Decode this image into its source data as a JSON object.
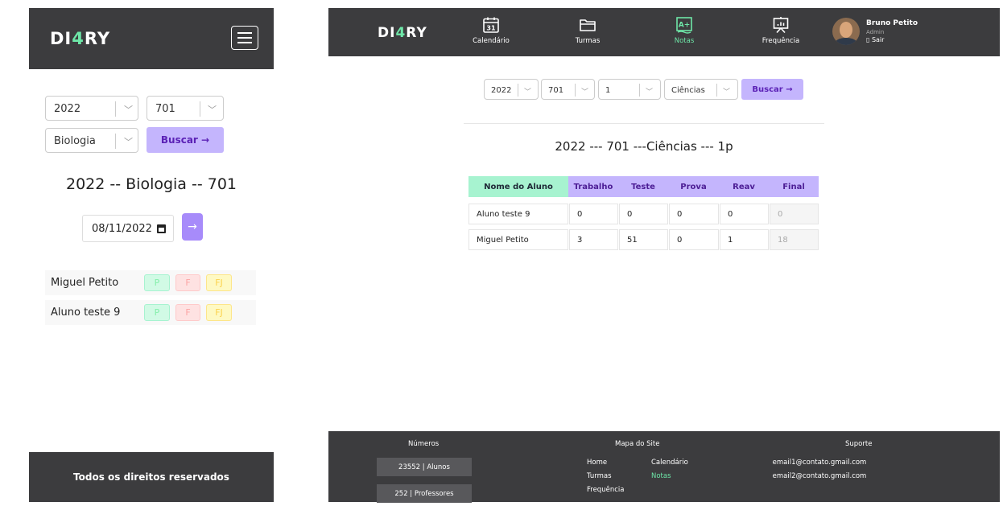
{
  "brand": {
    "logo_prefix": "DI",
    "logo_four": "4",
    "logo_suffix": "RY",
    "accent": "#6ee7a8",
    "purple": "#a78bfa"
  },
  "mobile": {
    "filters": {
      "year": "2022",
      "class": "701",
      "subject": "Biologia",
      "search_label": "Buscar →"
    },
    "title": "2022 -- Biologia -- 701",
    "date": "08/11/2022",
    "submit_arrow": "→",
    "attendance": [
      {
        "name": "Miguel Petito",
        "p": "P",
        "f": "F",
        "fj": "FJ"
      },
      {
        "name": "Aluno teste 9",
        "p": "P",
        "f": "F",
        "fj": "FJ"
      }
    ],
    "footer": "Todos os direitos reservados"
  },
  "desktop": {
    "nav": [
      {
        "label": "Calendário",
        "icon": "calendar-icon",
        "day": "31"
      },
      {
        "label": "Turmas",
        "icon": "folder-icon"
      },
      {
        "label": "Notas",
        "icon": "grades-icon",
        "badge": "A+"
      },
      {
        "label": "Frequência",
        "icon": "presentation-chart-icon"
      }
    ],
    "user": {
      "name": "Bruno Petito",
      "role": "Admin",
      "logout": "▯ Sair"
    },
    "filters": {
      "year": "2022",
      "class": "701",
      "period": "1",
      "subject": "Ciências",
      "search_label": "Buscar →"
    },
    "title": "2022 --- 701 ---Ciências --- 1p",
    "table": {
      "headers": [
        "Nome do Aluno",
        "Trabalho",
        "Teste",
        "Prova",
        "Reav",
        "Final"
      ],
      "rows": [
        [
          "Aluno teste 9",
          "0",
          "0",
          "0",
          "0",
          "0"
        ],
        [
          "Miguel Petito",
          "3",
          "51",
          "0",
          "1",
          "18"
        ]
      ]
    },
    "footer": {
      "numbers_heading": "Números",
      "students": "23552 | Alunos",
      "teachers": "252 | Professores",
      "sitemap_heading": "Mapa do Site",
      "links": {
        "home": "Home",
        "calendar": "Calendário",
        "classes": "Turmas",
        "grades": "Notas",
        "attendance": "Frequência"
      },
      "support_heading": "Suporte",
      "email1": "email1@contato.gmail.com",
      "email2": "email2@contato.gmail.com"
    }
  }
}
